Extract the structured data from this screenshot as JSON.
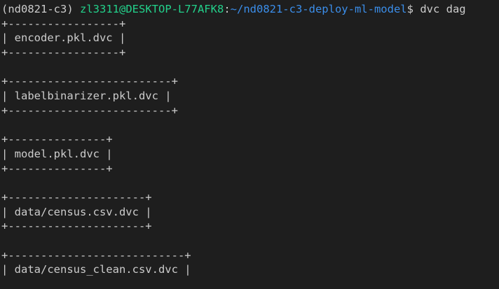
{
  "prompt": {
    "env": "(nd0821-c3)",
    "user_host": "zl3311@DESKTOP-L77AFK8",
    "separator": ":",
    "path": "~/nd0821-c3-deploy-ml-model",
    "dollar": "$",
    "command": "dvc dag"
  },
  "colors": {
    "background": "#1e1e1e",
    "text": "#cccccc",
    "user_host": "#23d18b",
    "path": "#3b8eea"
  },
  "dag_nodes": [
    {
      "top": "+-----------------+",
      "label": "| encoder.pkl.dvc |",
      "bottom": "+-----------------+"
    },
    {
      "top": "+-------------------------+",
      "label": "| labelbinarizer.pkl.dvc |",
      "bottom": "+-------------------------+"
    },
    {
      "top": "+---------------+",
      "label": "| model.pkl.dvc |",
      "bottom": "+---------------+"
    },
    {
      "top": "+---------------------+",
      "label": "| data/census.csv.dvc |",
      "bottom": "+---------------------+"
    },
    {
      "top": "+---------------------------+",
      "label": "| data/census_clean.csv.dvc |",
      "bottom": "+---------------------------+"
    }
  ]
}
